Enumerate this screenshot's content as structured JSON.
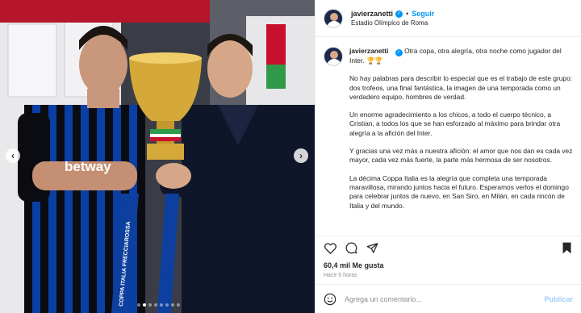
{
  "header": {
    "username": "javierzanetti",
    "follow_label": "Seguir",
    "location": "Estadio Olímpico de Roma"
  },
  "caption": {
    "username": "javierzanetti",
    "paragraphs": [
      "Otra copa, otra alegría, otra noche como jugador del Inter. 🏆🏆",
      "No hay palabras para describir lo especial que es el trabajo de este grupo: dos trofeos, una final fantástica, la imagen de una temporada como un verdadero equipo, hombres de verdad.",
      "Un enorme agradecimiento a los chicos, a todo el cuerpo técnico, a Cristian, a todos los que se han esforzado al máximo para brindar otra alegría a la afición del Inter.",
      "Y gracias una vez más a nuestra afición: el amor que nos dan es cada vez mayor, cada vez más fuerte, la parte más hermosa de ser nosotros.",
      "La décima Coppa Italia es la alegría que completa una temporada maravillosa, mirando juntos hacia el futuro. Esperamos verlos el domingo para celebrar juntos de nuevo, en San Siro, en Milán, en cada rincón de Italia y del mundo."
    ]
  },
  "stats": {
    "likes": "60,4 mil Me gusta",
    "time": "Hace 5 horas"
  },
  "comment": {
    "placeholder": "Agrega un comentario...",
    "publish_label": "Publicar"
  },
  "photo": {
    "jersey_text": "betway",
    "trophy_ribbon_text": "COPPA ITALIA FRECCIAROSSA",
    "slide_count": 8,
    "active_slide": 2
  },
  "colors": {
    "accent": "#0095f6",
    "inter_blue": "#0a3fa3",
    "inter_black": "#0b0b12"
  }
}
